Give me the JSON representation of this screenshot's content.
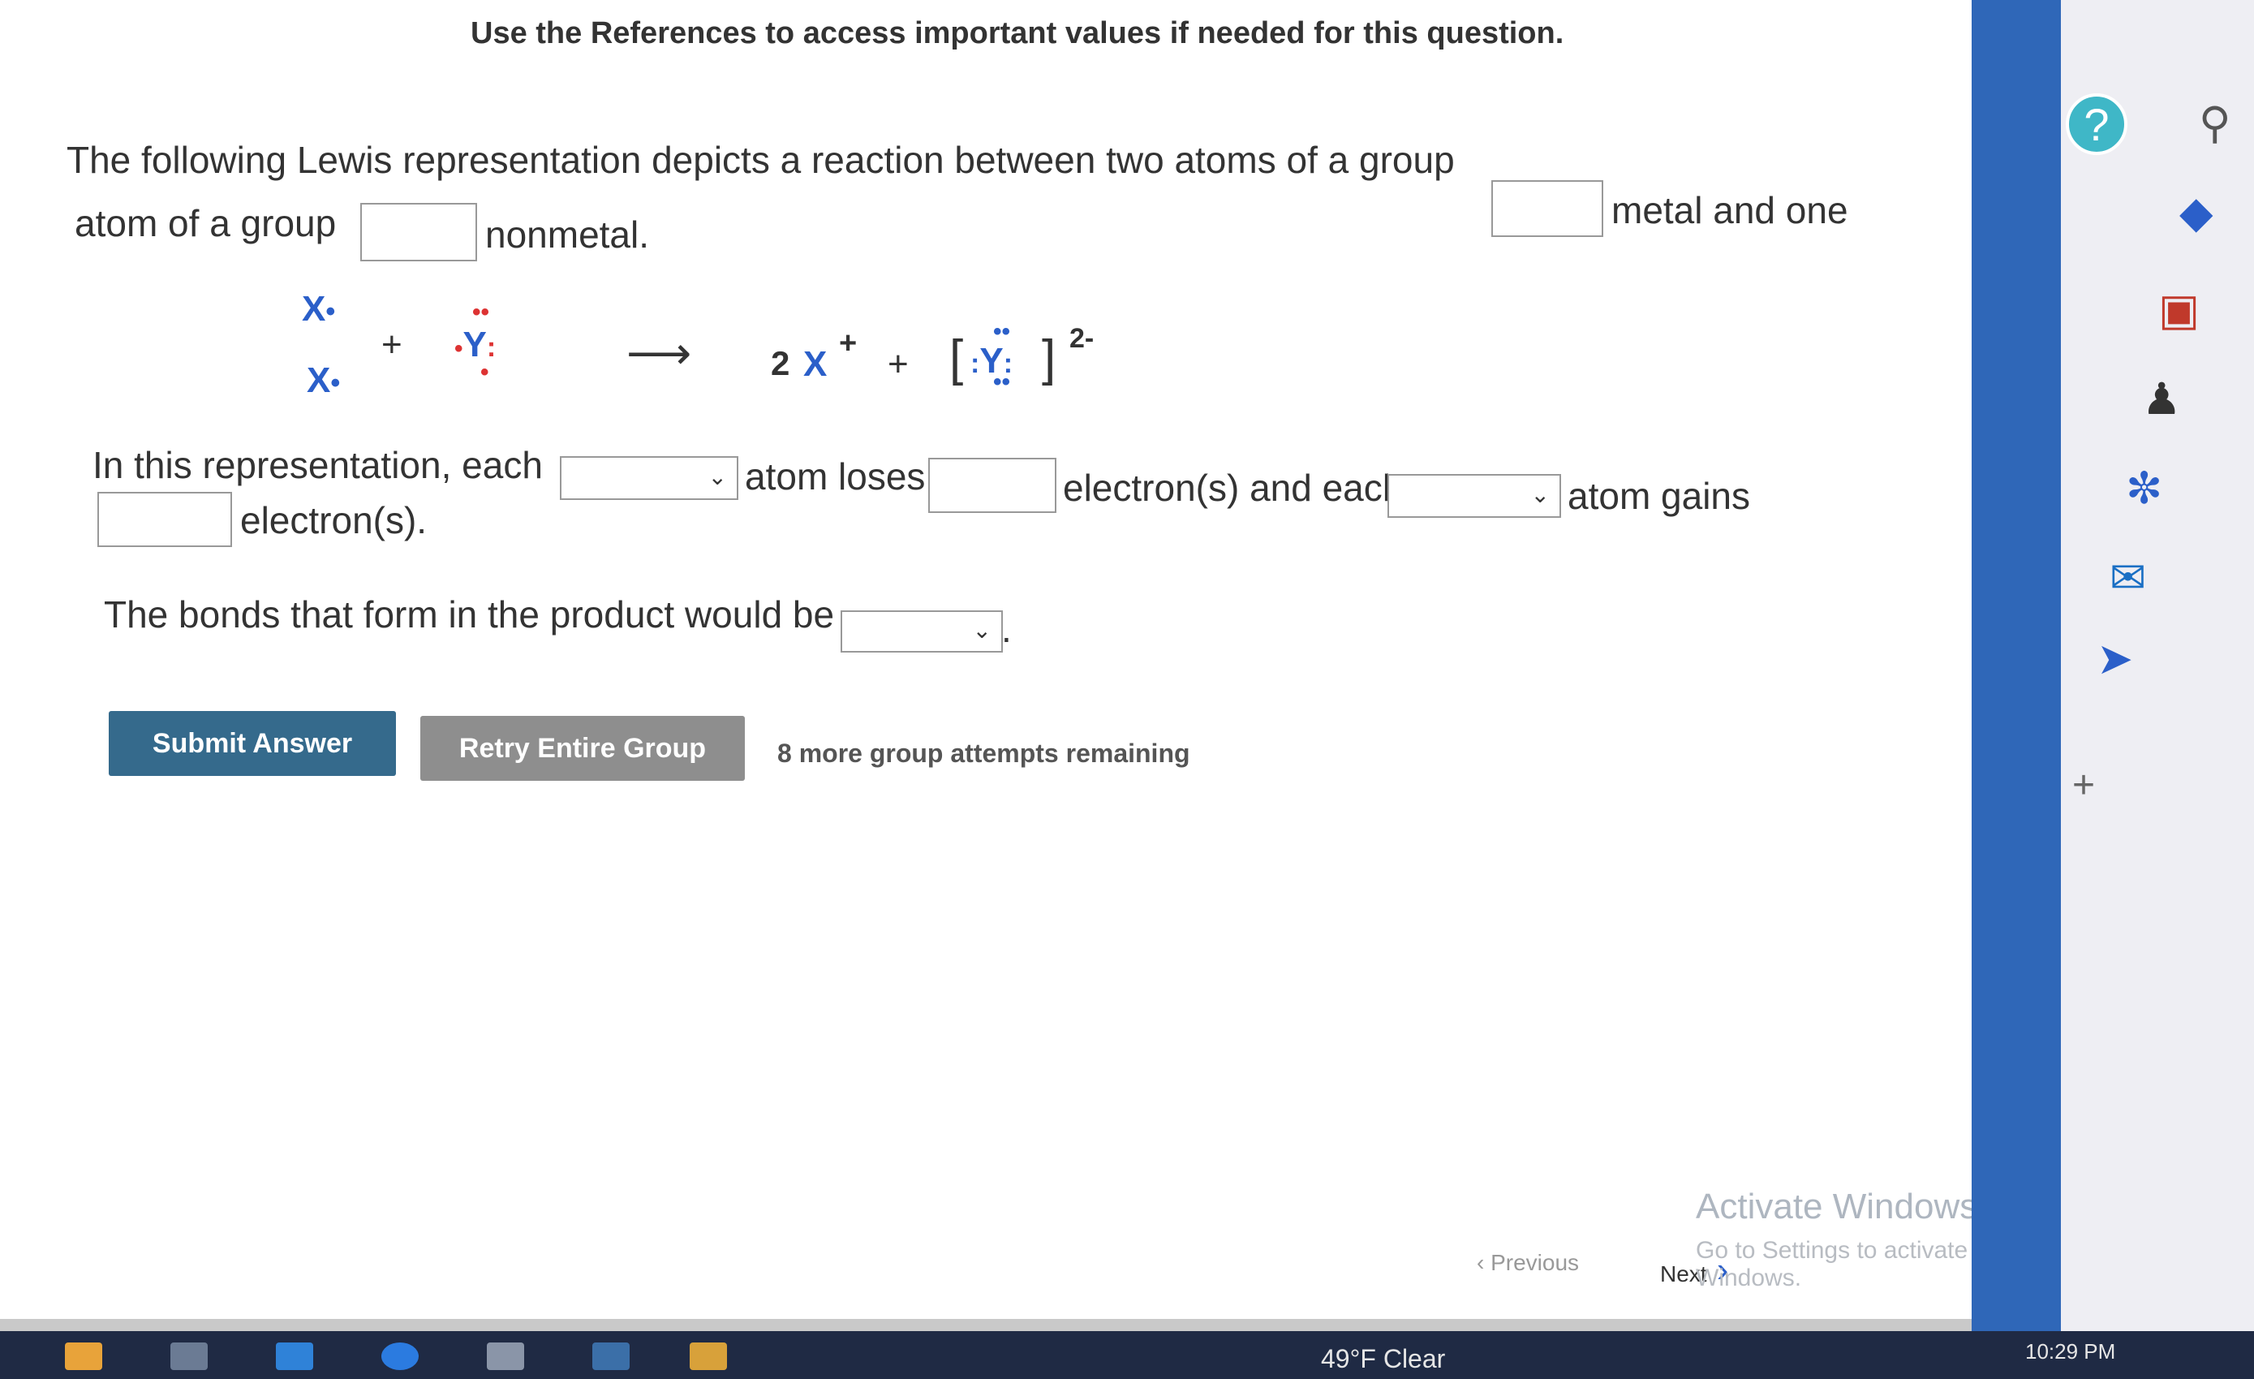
{
  "reference_bar": "Use the References to access important values if needed for this question.",
  "question": {
    "sentence1_part1": "The following Lewis representation depicts a reaction between two atoms of a group",
    "sentence1_part2": "metal and one",
    "sentence1_part3": "atom of a group",
    "sentence1_part4": "nonmetal."
  },
  "lewis": {
    "x_atom": "X",
    "y_atom": "Y",
    "plus": "+",
    "arrow": "⟶",
    "product_coef": "2",
    "product_charge": "+",
    "anion_charge": "2-"
  },
  "representation": {
    "part1": "In this representation, each",
    "part2": "atom loses",
    "part3": "electron(s) and each",
    "part4": "atom gains",
    "part5": "electron(s)."
  },
  "bonds": {
    "text": "The bonds that form in the product would be",
    "period": "."
  },
  "buttons": {
    "submit": "Submit Answer",
    "retry": "Retry Entire Group"
  },
  "attempts": "8 more group attempts remaining",
  "nav": {
    "previous": "Previous",
    "next": "Next"
  },
  "watermark": {
    "title": "Activate Windows",
    "subtitle": "Go to Settings to activate Windows."
  },
  "taskbar": {
    "weather": "49°F  Clear",
    "time": "10:29 PM"
  },
  "colors": {
    "submit": "#356a8c",
    "retry": "#8e8e8e",
    "lewis_blue": "#2b5fc9",
    "lewis_red": "#d33333"
  }
}
